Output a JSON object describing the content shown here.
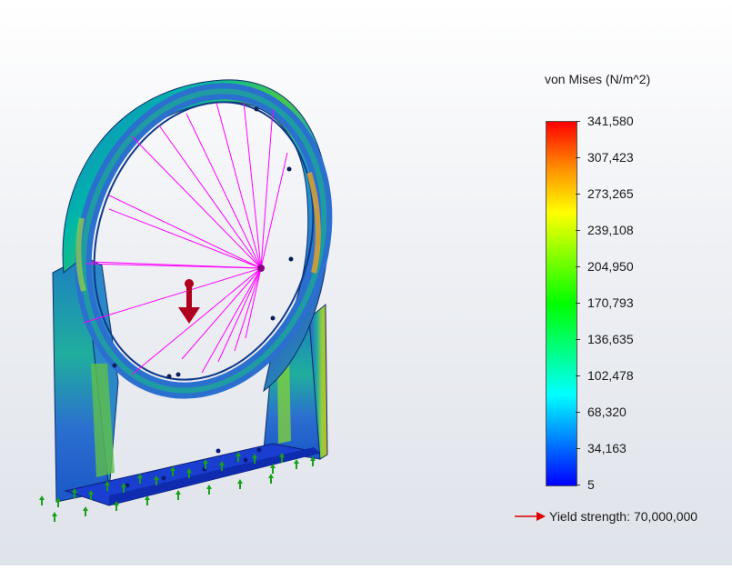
{
  "legend": {
    "title": "von Mises (N/m^2)",
    "ticks": [
      "341,580",
      "307,423",
      "273,265",
      "239,108",
      "204,950",
      "170,793",
      "136,635",
      "102,478",
      "68,320",
      "34,163",
      "5"
    ],
    "colors": [
      "#ff0000",
      "#ff8c00",
      "#ffff00",
      "#7fff00",
      "#00ff00",
      "#00ff7f",
      "#00ffff",
      "#0080ff",
      "#0000ff"
    ]
  },
  "yield": {
    "label": "Yield strength:",
    "value": "70,000,000",
    "arrow_color": "#e00000"
  },
  "model": {
    "load_color": "#b00020",
    "spoke_color": "#ff00ff",
    "fixture_color": "#18a018"
  }
}
